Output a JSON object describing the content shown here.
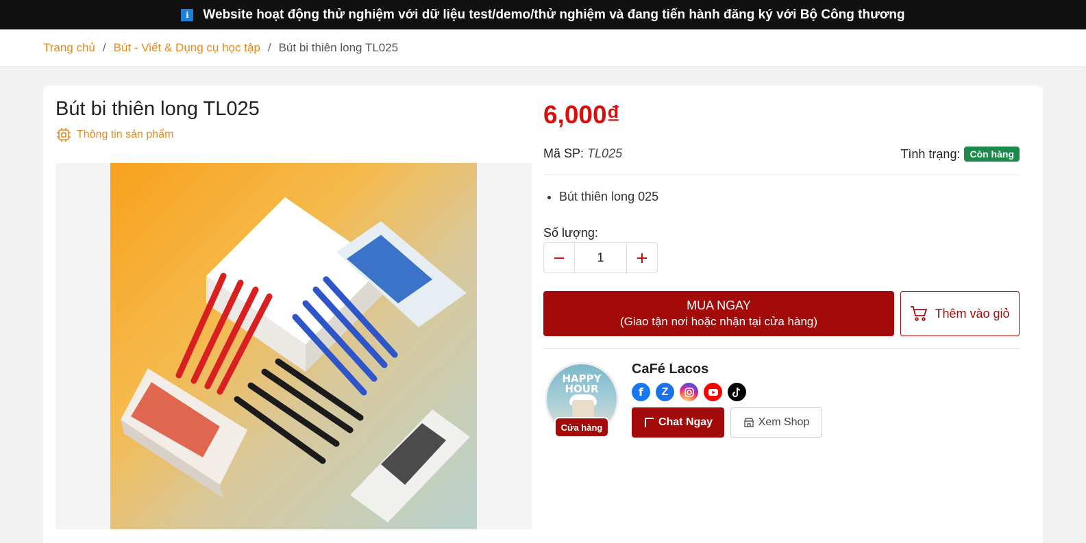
{
  "notice": {
    "icon": "info-icon",
    "text": "Website hoạt động thử nghiệm với dữ liệu test/demo/thử nghiệm và đang tiến hành đăng ký với Bộ Công thương"
  },
  "breadcrumb": {
    "home": "Trang chủ",
    "category": "Bút - Viết & Dụng cụ học tập",
    "current": "Bút bi thiên long TL025",
    "separator": "/"
  },
  "product": {
    "title": "Bút bi thiên long TL025",
    "info_label": "Thông tin sản phẩm",
    "price": "6,000₫",
    "sku_label": "Mã SP:",
    "sku_value": "TL025",
    "status_label": "Tình trạng:",
    "status_value": "Còn hàng",
    "features": [
      "Bút thiên long 025"
    ],
    "quantity_label": "Số lượng:",
    "quantity_value": "1",
    "buy_now_title": "MUA NGAY",
    "buy_now_sub": "(Giao tận nơi hoặc nhận tại cửa hàng)",
    "add_to_cart": "Thêm vào giỏ"
  },
  "shop": {
    "name": "CaFé Lacos",
    "avatar_text_1": "HAPPY",
    "avatar_text_2": "HOUR",
    "badge": "Cửa hàng",
    "chat_button": "Chat Ngay",
    "view_shop_button": "Xem Shop",
    "socials": [
      "facebook-icon",
      "zalo-icon",
      "instagram-icon",
      "youtube-icon",
      "tiktok-icon"
    ]
  },
  "colors": {
    "accent_orange": "#e8891c",
    "price_red": "#d80f0f",
    "primary_dark_red": "#a30a0a",
    "status_green": "#1b8a4a"
  }
}
